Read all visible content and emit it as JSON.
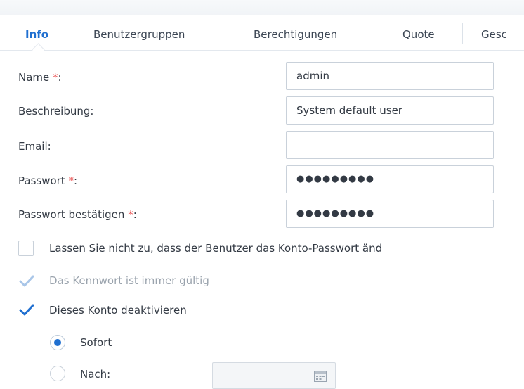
{
  "tabs": [
    {
      "label": "Info",
      "active": true
    },
    {
      "label": "Benutzergruppen",
      "active": false
    },
    {
      "label": "Berechtigungen",
      "active": false
    },
    {
      "label": "Quote",
      "active": false
    },
    {
      "label": "Gesc",
      "active": false
    }
  ],
  "form": {
    "name": {
      "label": "Name",
      "required_mark": "*",
      "suffix": ":",
      "value": "admin"
    },
    "description": {
      "label": "Beschreibung:",
      "value": "System default user"
    },
    "email": {
      "label": "Email:",
      "value": ""
    },
    "password": {
      "label": "Passwort",
      "required_mark": "*",
      "suffix": ":",
      "value": "●●●●●●●●●"
    },
    "password_confirm": {
      "label": "Passwort bestätigen",
      "required_mark": "*",
      "suffix": ":",
      "value": "●●●●●●●●●"
    }
  },
  "options": {
    "disallow_change": {
      "label": "Lassen Sie nicht zu, dass der Benutzer das Konto-Passwort änd",
      "checked": false
    },
    "never_expire": {
      "label": "Das Kennwort ist immer gültig",
      "checked": true,
      "disabled": true
    },
    "deactivate": {
      "label": "Dieses Konto deaktivieren",
      "checked": true
    }
  },
  "deactivate_when": {
    "immediately": {
      "label": "Sofort",
      "selected": true
    },
    "after": {
      "label": "Nach:",
      "selected": false,
      "date_value": ""
    }
  },
  "colors": {
    "accent": "#1f6fd0",
    "required": "#e94f4f",
    "checkmark": "#1f6fd0",
    "checkmark_disabled": "#a9c6e8"
  }
}
